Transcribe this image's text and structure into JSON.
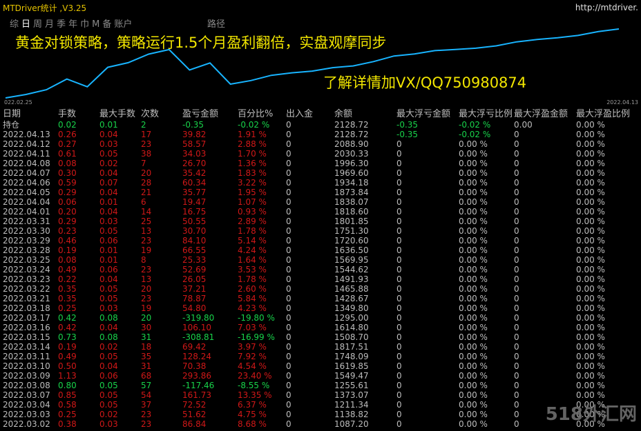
{
  "window": {
    "title": "MTDriver统计 ,V3.25",
    "url": "http://mtdriver."
  },
  "tabs": [
    "综",
    "日",
    "周",
    "月",
    "季",
    "年",
    "巾",
    "M",
    "备",
    "账户"
  ],
  "active_tab": 1,
  "path_label": "路径",
  "headline1": "黄金对锁策略，策略运行1.5个月盈利翻倍，实盘观摩同步",
  "headline2": "了解详情加VX/QQ750980874",
  "chart": {
    "start_date": "022.02.25",
    "end_date": "2022.04.13",
    "balance": [
      1087.2,
      1138.82,
      1211.34,
      1373.07,
      1255.61,
      1549.47,
      1619.85,
      1748.09,
      1817.51,
      1508.7,
      1614.8,
      1295.0,
      1349.8,
      1428.67,
      1465.88,
      1491.93,
      1544.62,
      1569.95,
      1636.5,
      1720.6,
      1751.3,
      1801.85,
      1818.6,
      1838.07,
      1873.84,
      1934.18,
      1969.6,
      1996.3,
      2030.31,
      2088.9,
      2128.72
    ]
  },
  "headers": [
    "日期",
    "手数",
    "最大手数",
    "次数",
    "盈亏金额",
    "百分比%",
    "出入金",
    "余额",
    "最大浮亏金额",
    "最大浮亏比例",
    "最大浮盈金额",
    "最大浮盈比例"
  ],
  "holding_row": {
    "date": "持仓",
    "lots": "0.02",
    "maxlots": "0.01",
    "count": "2",
    "pl": "-0.35",
    "pct": "-0.02 %",
    "flow": "0",
    "bal": "2128.72",
    "mfl": "-0.35",
    "mflp": "-0.02 %",
    "mfp": "0.00",
    "mfpp": "0.00 %",
    "color": "green"
  },
  "rows": [
    {
      "date": "2022.04.13",
      "lots": "0.26",
      "maxlots": "0.04",
      "count": "17",
      "pl": "39.82",
      "pct": "1.91 %",
      "flow": "0",
      "bal": "2128.72",
      "mfl": "-0.35",
      "mflp": "-0.02 %",
      "mfp": "0",
      "mfpp": "0.00 %",
      "color": "red"
    },
    {
      "date": "2022.04.12",
      "lots": "0.27",
      "maxlots": "0.03",
      "count": "23",
      "pl": "58.57",
      "pct": "2.88 %",
      "flow": "0",
      "bal": "2088.90",
      "mfl": "0",
      "mflp": "0.00 %",
      "mfp": "0",
      "mfpp": "0.00 %",
      "color": "red"
    },
    {
      "date": "2022.04.11",
      "lots": "0.61",
      "maxlots": "0.05",
      "count": "38",
      "pl": "34.03",
      "pct": "1.70 %",
      "flow": "0",
      "bal": "2030.33",
      "mfl": "0",
      "mflp": "0.00 %",
      "mfp": "0",
      "mfpp": "0.00 %",
      "color": "red"
    },
    {
      "date": "2022.04.08",
      "lots": "0.08",
      "maxlots": "0.02",
      "count": "7",
      "pl": "26.70",
      "pct": "1.36 %",
      "flow": "0",
      "bal": "1996.30",
      "mfl": "0",
      "mflp": "0.00 %",
      "mfp": "0",
      "mfpp": "0.00 %",
      "color": "red"
    },
    {
      "date": "2022.04.07",
      "lots": "0.30",
      "maxlots": "0.04",
      "count": "20",
      "pl": "35.42",
      "pct": "1.83 %",
      "flow": "0",
      "bal": "1969.60",
      "mfl": "0",
      "mflp": "0.00 %",
      "mfp": "0",
      "mfpp": "0.00 %",
      "color": "red"
    },
    {
      "date": "2022.04.06",
      "lots": "0.59",
      "maxlots": "0.07",
      "count": "28",
      "pl": "60.34",
      "pct": "3.22 %",
      "flow": "0",
      "bal": "1934.18",
      "mfl": "0",
      "mflp": "0.00 %",
      "mfp": "0",
      "mfpp": "0.00 %",
      "color": "red"
    },
    {
      "date": "2022.04.05",
      "lots": "0.29",
      "maxlots": "0.04",
      "count": "21",
      "pl": "35.77",
      "pct": "1.95 %",
      "flow": "0",
      "bal": "1873.84",
      "mfl": "0",
      "mflp": "0.00 %",
      "mfp": "0",
      "mfpp": "0.00 %",
      "color": "red"
    },
    {
      "date": "2022.04.04",
      "lots": "0.06",
      "maxlots": "0.01",
      "count": "6",
      "pl": "19.47",
      "pct": "1.07 %",
      "flow": "0",
      "bal": "1838.07",
      "mfl": "0",
      "mflp": "0.00 %",
      "mfp": "0",
      "mfpp": "0.00 %",
      "color": "red"
    },
    {
      "date": "2022.04.01",
      "lots": "0.20",
      "maxlots": "0.04",
      "count": "14",
      "pl": "16.75",
      "pct": "0.93 %",
      "flow": "0",
      "bal": "1818.60",
      "mfl": "0",
      "mflp": "0.00 %",
      "mfp": "0",
      "mfpp": "0.00 %",
      "color": "red"
    },
    {
      "date": "2022.03.31",
      "lots": "0.29",
      "maxlots": "0.03",
      "count": "25",
      "pl": "50.55",
      "pct": "2.89 %",
      "flow": "0",
      "bal": "1801.85",
      "mfl": "0",
      "mflp": "0.00 %",
      "mfp": "0",
      "mfpp": "0.00 %",
      "color": "red"
    },
    {
      "date": "2022.03.30",
      "lots": "0.23",
      "maxlots": "0.05",
      "count": "13",
      "pl": "30.70",
      "pct": "1.78 %",
      "flow": "0",
      "bal": "1751.30",
      "mfl": "0",
      "mflp": "0.00 %",
      "mfp": "0",
      "mfpp": "0.00 %",
      "color": "red"
    },
    {
      "date": "2022.03.29",
      "lots": "0.46",
      "maxlots": "0.06",
      "count": "23",
      "pl": "84.10",
      "pct": "5.14 %",
      "flow": "0",
      "bal": "1720.60",
      "mfl": "0",
      "mflp": "0.00 %",
      "mfp": "0",
      "mfpp": "0.00 %",
      "color": "red"
    },
    {
      "date": "2022.03.28",
      "lots": "0.19",
      "maxlots": "0.01",
      "count": "19",
      "pl": "66.55",
      "pct": "4.24 %",
      "flow": "0",
      "bal": "1636.50",
      "mfl": "0",
      "mflp": "0.00 %",
      "mfp": "0",
      "mfpp": "0.00 %",
      "color": "red"
    },
    {
      "date": "2022.03.25",
      "lots": "0.08",
      "maxlots": "0.01",
      "count": "8",
      "pl": "25.33",
      "pct": "1.64 %",
      "flow": "0",
      "bal": "1569.95",
      "mfl": "0",
      "mflp": "0.00 %",
      "mfp": "0",
      "mfpp": "0.00 %",
      "color": "red"
    },
    {
      "date": "2022.03.24",
      "lots": "0.49",
      "maxlots": "0.06",
      "count": "23",
      "pl": "52.69",
      "pct": "3.53 %",
      "flow": "0",
      "bal": "1544.62",
      "mfl": "0",
      "mflp": "0.00 %",
      "mfp": "0",
      "mfpp": "0.00 %",
      "color": "red"
    },
    {
      "date": "2022.03.23",
      "lots": "0.22",
      "maxlots": "0.04",
      "count": "13",
      "pl": "26.05",
      "pct": "1.78 %",
      "flow": "0",
      "bal": "1491.93",
      "mfl": "0",
      "mflp": "0.00 %",
      "mfp": "0",
      "mfpp": "0.00 %",
      "color": "red"
    },
    {
      "date": "2022.03.22",
      "lots": "0.35",
      "maxlots": "0.05",
      "count": "20",
      "pl": "37.21",
      "pct": "2.60 %",
      "flow": "0",
      "bal": "1465.88",
      "mfl": "0",
      "mflp": "0.00 %",
      "mfp": "0",
      "mfpp": "0.00 %",
      "color": "red"
    },
    {
      "date": "2022.03.21",
      "lots": "0.35",
      "maxlots": "0.05",
      "count": "23",
      "pl": "78.87",
      "pct": "5.84 %",
      "flow": "0",
      "bal": "1428.67",
      "mfl": "0",
      "mflp": "0.00 %",
      "mfp": "0",
      "mfpp": "0.00 %",
      "color": "red"
    },
    {
      "date": "2022.03.18",
      "lots": "0.25",
      "maxlots": "0.03",
      "count": "19",
      "pl": "54.80",
      "pct": "4.23 %",
      "flow": "0",
      "bal": "1349.80",
      "mfl": "0",
      "mflp": "0.00 %",
      "mfp": "0",
      "mfpp": "0.00 %",
      "color": "red"
    },
    {
      "date": "2022.03.17",
      "lots": "0.42",
      "maxlots": "0.08",
      "count": "20",
      "pl": "-319.80",
      "pct": "-19.80 %",
      "flow": "0",
      "bal": "1295.00",
      "mfl": "0",
      "mflp": "0.00 %",
      "mfp": "0",
      "mfpp": "0.00 %",
      "color": "green"
    },
    {
      "date": "2022.03.16",
      "lots": "0.42",
      "maxlots": "0.04",
      "count": "30",
      "pl": "106.10",
      "pct": "7.03 %",
      "flow": "0",
      "bal": "1614.80",
      "mfl": "0",
      "mflp": "0.00 %",
      "mfp": "0",
      "mfpp": "0.00 %",
      "color": "red"
    },
    {
      "date": "2022.03.15",
      "lots": "0.73",
      "maxlots": "0.08",
      "count": "31",
      "pl": "-308.81",
      "pct": "-16.99 %",
      "flow": "0",
      "bal": "1508.70",
      "mfl": "0",
      "mflp": "0.00 %",
      "mfp": "0",
      "mfpp": "0.00 %",
      "color": "green"
    },
    {
      "date": "2022.03.14",
      "lots": "0.19",
      "maxlots": "0.02",
      "count": "18",
      "pl": "69.42",
      "pct": "3.97 %",
      "flow": "0",
      "bal": "1817.51",
      "mfl": "0",
      "mflp": "0.00 %",
      "mfp": "0",
      "mfpp": "0.00 %",
      "color": "red"
    },
    {
      "date": "2022.03.11",
      "lots": "0.49",
      "maxlots": "0.05",
      "count": "35",
      "pl": "128.24",
      "pct": "7.92 %",
      "flow": "0",
      "bal": "1748.09",
      "mfl": "0",
      "mflp": "0.00 %",
      "mfp": "0",
      "mfpp": "0.00 %",
      "color": "red"
    },
    {
      "date": "2022.03.10",
      "lots": "0.50",
      "maxlots": "0.04",
      "count": "31",
      "pl": "70.38",
      "pct": "4.54 %",
      "flow": "0",
      "bal": "1619.85",
      "mfl": "0",
      "mflp": "0.00 %",
      "mfp": "0",
      "mfpp": "0.00 %",
      "color": "red"
    },
    {
      "date": "2022.03.09",
      "lots": "1.13",
      "maxlots": "0.06",
      "count": "68",
      "pl": "293.86",
      "pct": "23.40 %",
      "flow": "0",
      "bal": "1549.47",
      "mfl": "0",
      "mflp": "0.00 %",
      "mfp": "0",
      "mfpp": "0.00 %",
      "color": "red"
    },
    {
      "date": "2022.03.08",
      "lots": "0.80",
      "maxlots": "0.05",
      "count": "57",
      "pl": "-117.46",
      "pct": "-8.55 %",
      "flow": "0",
      "bal": "1255.61",
      "mfl": "0",
      "mflp": "0.00 %",
      "mfp": "0",
      "mfpp": "0.00 %",
      "color": "green"
    },
    {
      "date": "2022.03.07",
      "lots": "0.85",
      "maxlots": "0.05",
      "count": "54",
      "pl": "161.73",
      "pct": "13.35 %",
      "flow": "0",
      "bal": "1373.07",
      "mfl": "0",
      "mflp": "0.00 %",
      "mfp": "0",
      "mfpp": "0.00 %",
      "color": "red"
    },
    {
      "date": "2022.03.04",
      "lots": "0.58",
      "maxlots": "0.05",
      "count": "37",
      "pl": "72.52",
      "pct": "6.37 %",
      "flow": "0",
      "bal": "1211.34",
      "mfl": "0",
      "mflp": "0.00 %",
      "mfp": "0",
      "mfpp": "0.00 %",
      "color": "red"
    },
    {
      "date": "2022.03.03",
      "lots": "0.25",
      "maxlots": "0.02",
      "count": "23",
      "pl": "51.62",
      "pct": "4.75 %",
      "flow": "0",
      "bal": "1138.82",
      "mfl": "0",
      "mflp": "0.00 %",
      "mfp": "0",
      "mfpp": "0.00 %",
      "color": "red"
    },
    {
      "date": "2022.03.02",
      "lots": "0.38",
      "maxlots": "0.03",
      "count": "23",
      "pl": "86.84",
      "pct": "8.68 %",
      "flow": "0",
      "bal": "1087.20",
      "mfl": "0",
      "mflp": "0.00 %",
      "mfp": "0",
      "mfpp": "0.00 %",
      "color": "red"
    }
  ],
  "watermark": "518外汇网",
  "colors": {
    "gain": "#d01818",
    "loss": "#18d24a",
    "line": "#18b4ff",
    "headline": "#f2e600"
  }
}
